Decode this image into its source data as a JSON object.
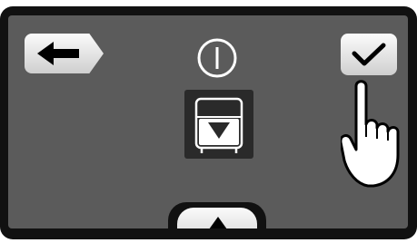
{
  "screen": {
    "background_color": "#5b5b5b",
    "bezel_color": "#111111",
    "button_color": "#e8e8e8"
  },
  "icons": {
    "back_button": "left-arrow-icon",
    "power": "power-icon",
    "confirm_button": "checkmark-icon",
    "center_function": "drain-down-arrow-icon",
    "bottom_tab": "up-triangle-icon",
    "pointer": "pointing-hand-icon"
  }
}
